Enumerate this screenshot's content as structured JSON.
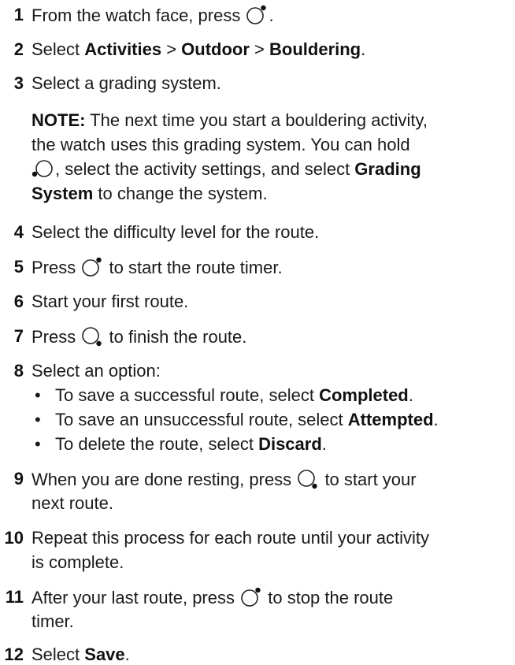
{
  "steps": [
    {
      "num": "1",
      "before": "From the watch face, press",
      "after": "."
    },
    {
      "num": "2",
      "t1": "Select ",
      "b1": "Activities",
      "t2": " > ",
      "b2": "Outdoor",
      "t3": " > ",
      "b3": "Bouldering",
      "t4": "."
    },
    {
      "num": "3",
      "text": "Select a grading system."
    },
    {
      "num": "4",
      "text": "Select the difficulty level for the route."
    },
    {
      "num": "5",
      "before": "Press",
      "after": "to start the route timer."
    },
    {
      "num": "6",
      "text": "Start your first route."
    },
    {
      "num": "7",
      "before": "Press",
      "after": "to finish the route."
    },
    {
      "num": "8",
      "text": "Select an option:"
    },
    {
      "num": "9",
      "before": "When you are done resting, press",
      "after": "to start your",
      "line2": "next route."
    },
    {
      "num": "10",
      "line1": "Repeat this process for each route until your activity",
      "line2": "is complete."
    },
    {
      "num": "11",
      "before": "After your last route, press",
      "after": "to stop the route",
      "line2": "timer."
    },
    {
      "num": "12",
      "t1": "Select ",
      "b1": "Save",
      "t2": "."
    }
  ],
  "note": {
    "label": "NOTE:",
    "line1": "The next time you start a bouldering activity,",
    "line2": "the watch uses this grading system. You can hold",
    "line3a": ", select the activity settings, and select ",
    "line3b": "Grading",
    "line4a": "System",
    "line4b": " to change the system."
  },
  "options": [
    {
      "bullet": "•",
      "text": "To save a successful route, select ",
      "bold": "Completed",
      "end": "."
    },
    {
      "bullet": "•",
      "text": "To save an unsuccessful route, select ",
      "bold": "Attempted",
      "end": "."
    },
    {
      "bullet": "•",
      "text": "To delete the route, select ",
      "bold": "Discard",
      "end": "."
    }
  ],
  "icons": {
    "start_stop": "watch-button-top-right-icon",
    "back_lap": "watch-button-bottom-right-icon",
    "light": "watch-button-left-icon"
  }
}
